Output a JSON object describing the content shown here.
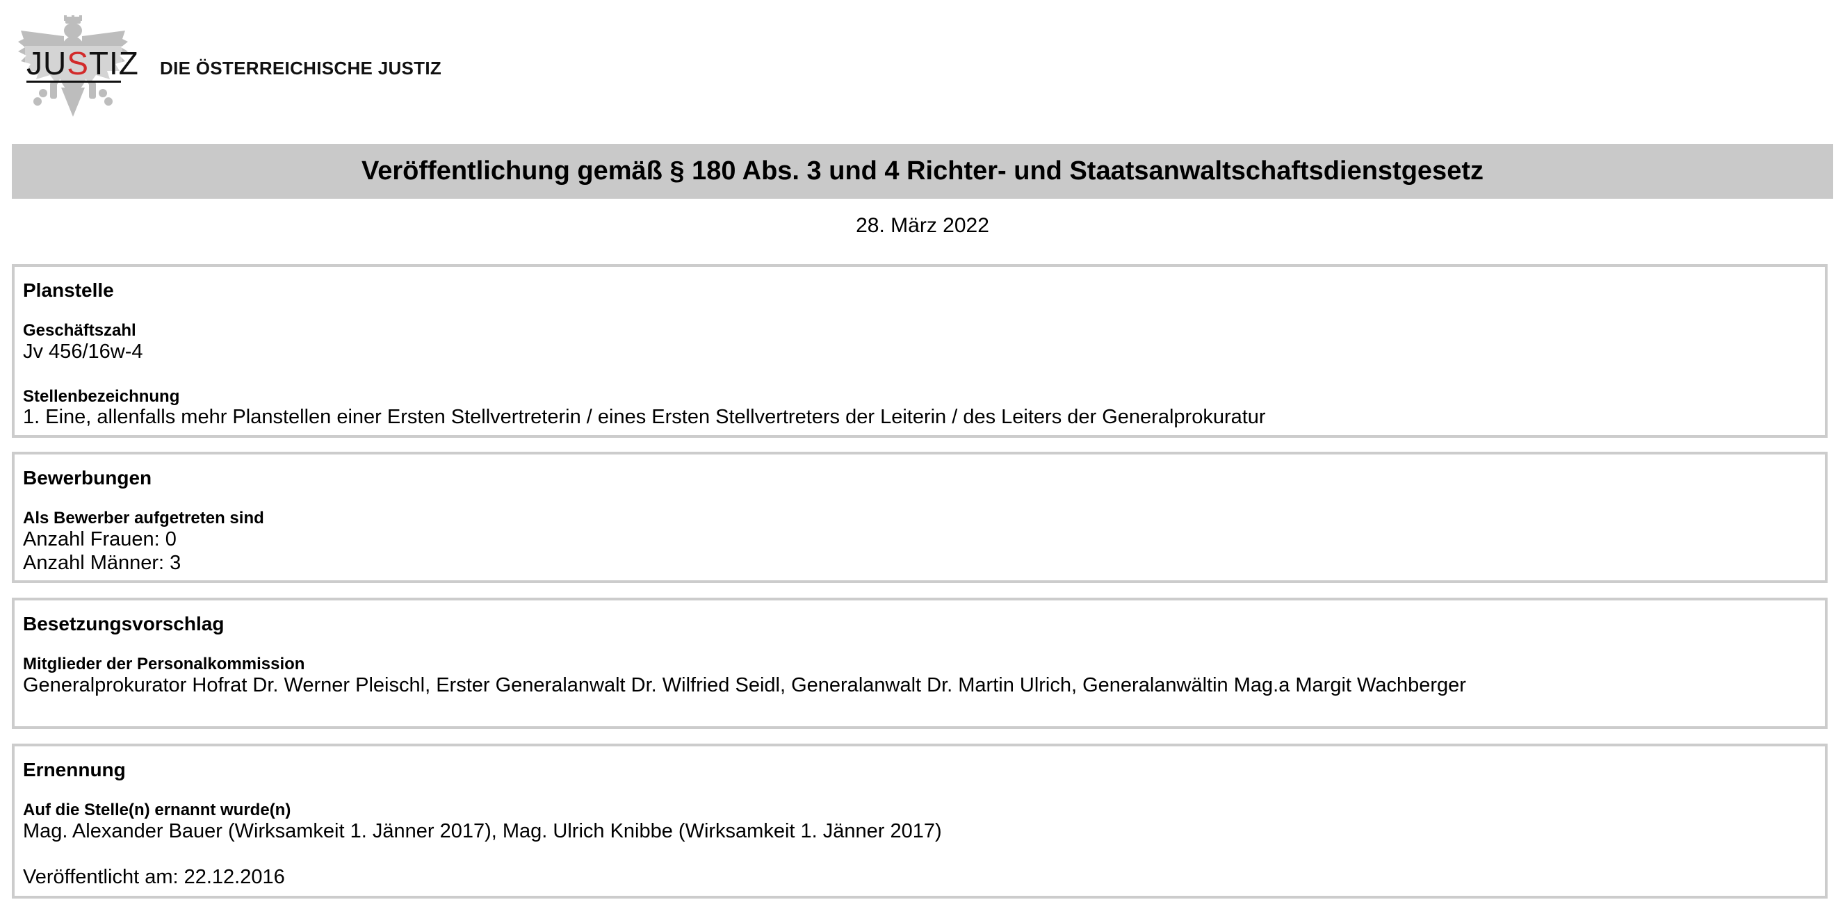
{
  "header": {
    "logo_text_before": "JU",
    "logo_text_s": "S",
    "logo_text_after": "TIZ",
    "org_name": "DIE ÖSTERREICHISCHE JUSTIZ"
  },
  "title": "Veröffentlichung gemäß § 180 Abs. 3 und 4 Richter- und Staatsanwaltschaftsdienstgesetz",
  "date": "28. März 2022",
  "sections": {
    "planstelle": {
      "heading": "Planstelle",
      "gz_label": "Geschäftszahl",
      "gz_value": "Jv 456/16w-4",
      "bez_label": "Stellenbezeichnung",
      "bez_value": "1. Eine, allenfalls mehr Planstellen einer Ersten Stellvertreterin / eines Ersten Stellvertreters der Leiterin / des Leiters der Generalprokuratur"
    },
    "bewerbungen": {
      "heading": "Bewerbungen",
      "label": "Als Bewerber aufgetreten sind",
      "frauen": "Anzahl Frauen: 0",
      "maenner": "Anzahl Männer: 3"
    },
    "besetzungsvorschlag": {
      "heading": "Besetzungsvorschlag",
      "label": "Mitglieder der Personalkommission",
      "value": "Generalprokurator Hofrat Dr. Werner Pleischl, Erster Generalanwalt Dr. Wilfried Seidl, Generalanwalt Dr. Martin Ulrich, Generalanwältin Mag.a Margit Wachberger"
    },
    "ernennung": {
      "heading": "Ernennung",
      "label": "Auf die Stelle(n) ernannt wurde(n)",
      "value": "Mag. Alexander Bauer (Wirksamkeit 1. Jänner 2017), Mag. Ulrich Knibbe (Wirksamkeit 1. Jänner 2017)",
      "published": "Veröffentlicht am: 22.12.2016"
    }
  },
  "colors": {
    "title_band": "#c9c9c9",
    "section_border": "#cccccc",
    "logo_accent": "#d22a2a",
    "eagle": "#bdbdbd"
  }
}
